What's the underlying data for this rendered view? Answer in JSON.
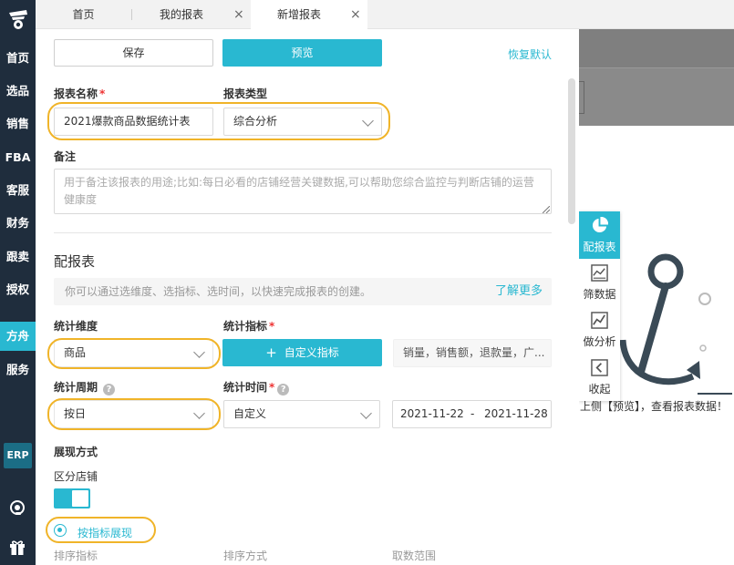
{
  "nav": {
    "items": [
      "首页",
      "选品",
      "销售",
      "FBA",
      "客服",
      "财务",
      "跟卖",
      "授权",
      "方舟",
      "服务"
    ],
    "active_index": 8,
    "erp_label": "ERP"
  },
  "tabs": [
    {
      "label": "首页",
      "closable": false
    },
    {
      "label": "我的报表",
      "closable": true
    },
    {
      "label": "新增报表",
      "closable": true,
      "active": true
    }
  ],
  "toolbar": {
    "save_label": "保存",
    "preview_label": "预览",
    "reset_label": "恢复默认"
  },
  "form": {
    "report_name_label": "报表名称",
    "report_name_value": "2021爆款商品数据统计表",
    "report_type_label": "报表类型",
    "report_type_value": "综合分析",
    "remark_label": "备注",
    "remark_placeholder": "用于备注该报表的用途;比如:每日必看的店铺经营关键数据,可以帮助您综合监控与判断店铺的运营健康度"
  },
  "config": {
    "section_title": "配报表",
    "info_text": "你可以通过选维度、选指标、选时间，以快速完成报表的创建。",
    "learn_more": "了解更多",
    "dimension_label": "统计维度",
    "dimension_value": "商品",
    "metric_label": "统计指标",
    "custom_metric_label": "自定义指标",
    "metrics_value": "销量，销售额，退款量，广...",
    "period_label": "统计周期",
    "period_value": "按日",
    "time_label": "统计时间",
    "time_mode_value": "自定义",
    "date_start": "2021-11-22",
    "date_sep": "-",
    "date_end": "2021-11-28",
    "display_label": "展现方式",
    "split_store_label": "区分店铺",
    "split_store_on": true,
    "radio_label": "按指标展现",
    "sort_metric_label": "排序指标",
    "sort_mode_label": "排序方式",
    "range_label": "取数范围"
  },
  "side_tools": [
    {
      "label": "配报表",
      "icon": "pie-chart-icon",
      "active": true
    },
    {
      "label": "筛数据",
      "icon": "filter-chart-icon",
      "active": false
    },
    {
      "label": "做分析",
      "icon": "line-chart-icon",
      "active": false
    },
    {
      "label": "收起",
      "icon": "chevron-left-icon",
      "active": false
    }
  ],
  "background_hint": "上侧【预览】，查看报表数据！",
  "colors": {
    "accent": "#29b8d1",
    "nav_bg": "#1f2d3d",
    "highlight": "#f0b429",
    "required": "#e33333"
  }
}
